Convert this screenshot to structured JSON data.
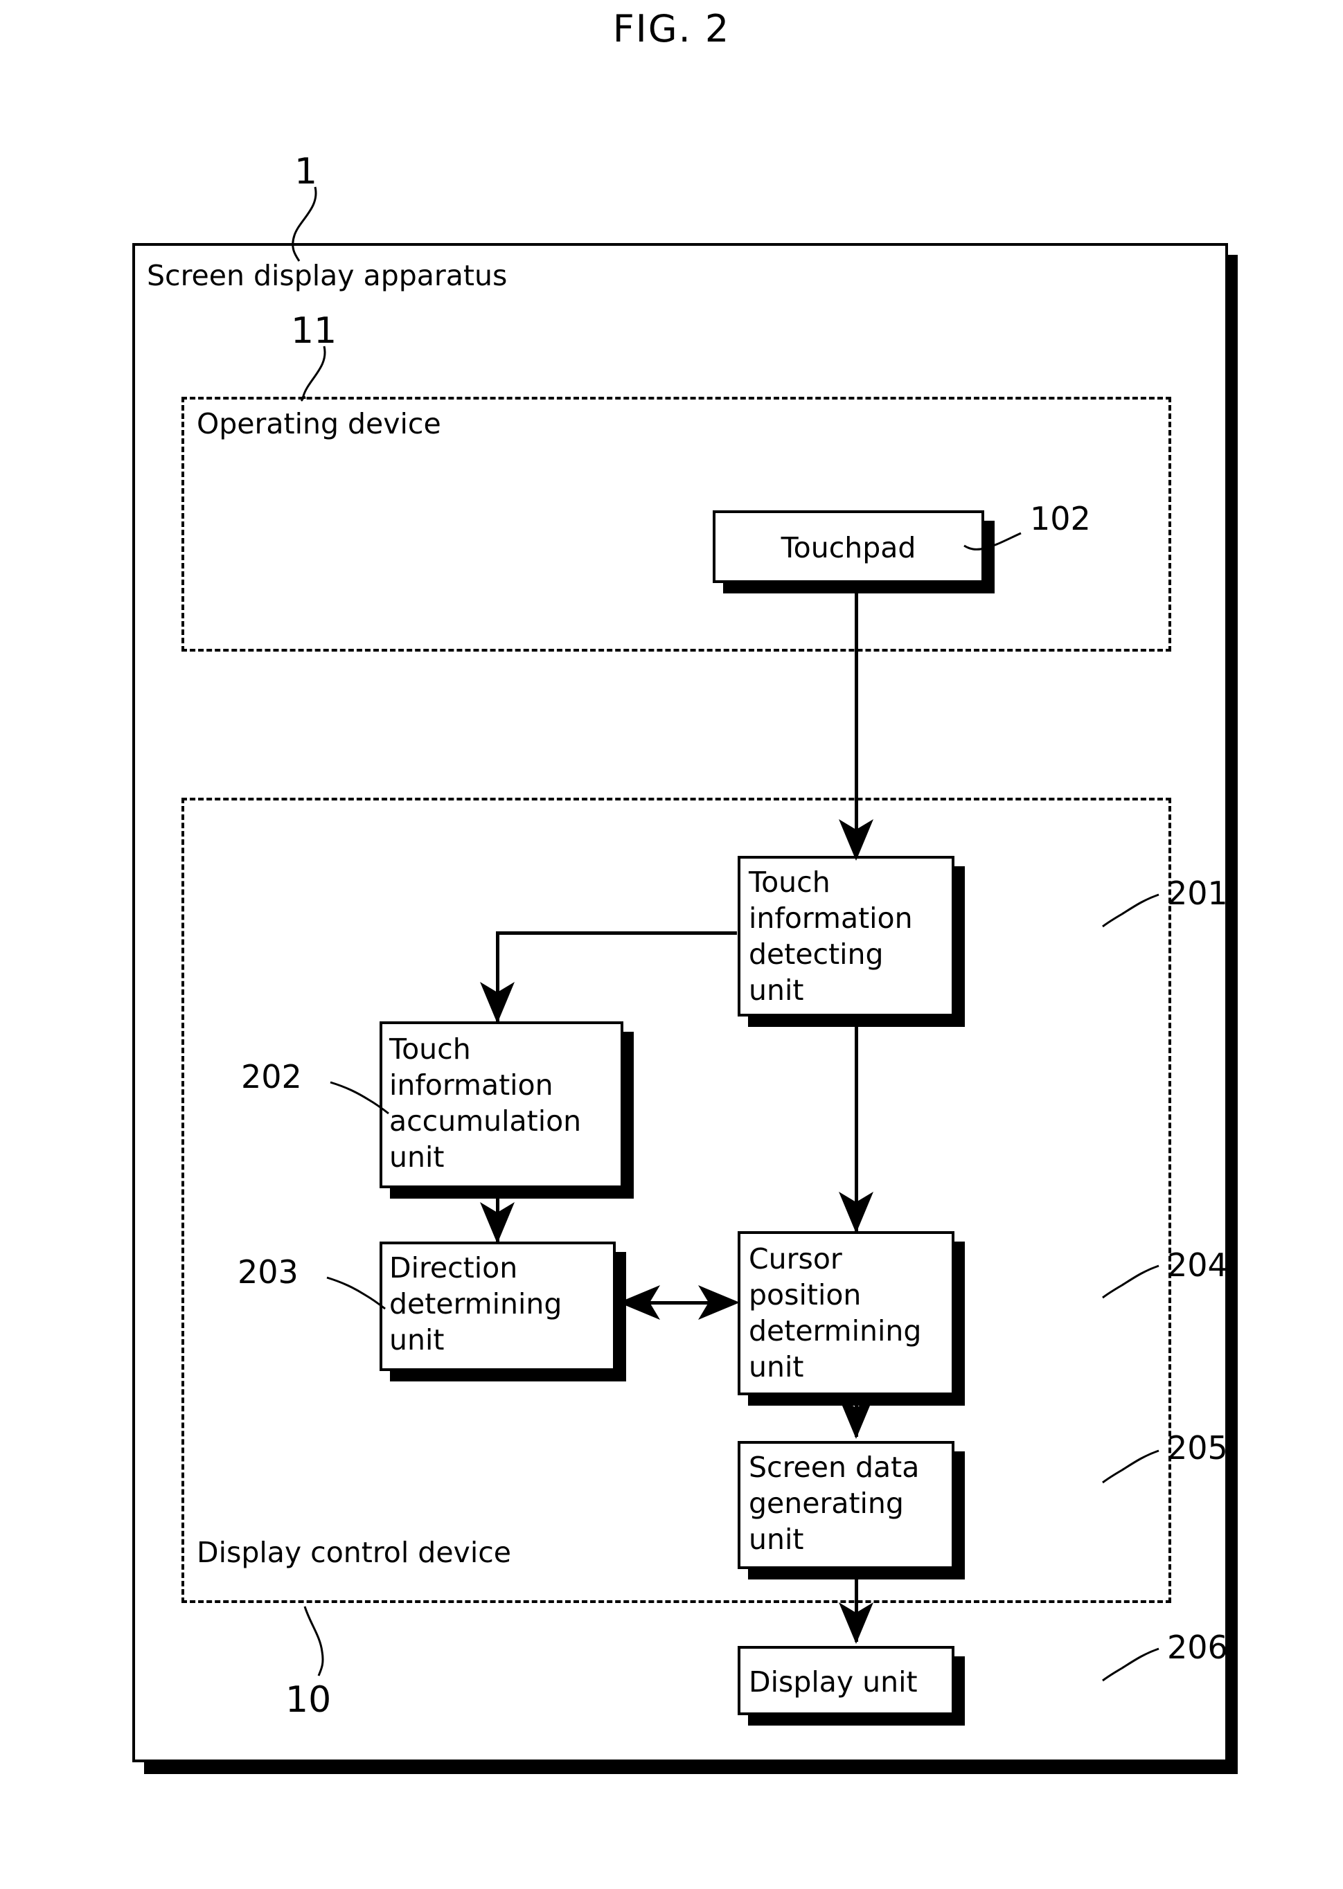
{
  "figure": {
    "title": "FIG. 2"
  },
  "apparatus": {
    "label": "Screen display apparatus",
    "ref": "1"
  },
  "operating_device": {
    "label": "Operating device",
    "ref": "11"
  },
  "display_control_device": {
    "label": "Display control device",
    "ref": "10"
  },
  "blocks": [
    {
      "id": "touchpad",
      "label": "Touchpad",
      "ref": "102"
    },
    {
      "id": "touch-information-detecting",
      "label": "Touch\ninformation\ndetecting\nunit",
      "ref": "201"
    },
    {
      "id": "touch-information-accumulation",
      "label": "Touch\ninformation\naccumulation\nunit",
      "ref": "202"
    },
    {
      "id": "direction-determining",
      "label": "Direction\ndetermining\nunit",
      "ref": "203"
    },
    {
      "id": "cursor-position-determining",
      "label": "Cursor\nposition\ndetermining\nunit",
      "ref": "204"
    },
    {
      "id": "screen-data-generating",
      "label": "Screen data\ngenerating\nunit",
      "ref": "205"
    },
    {
      "id": "display",
      "label": "Display unit",
      "ref": "206"
    }
  ],
  "colors": {
    "stroke": "#000000",
    "background": "#ffffff"
  }
}
